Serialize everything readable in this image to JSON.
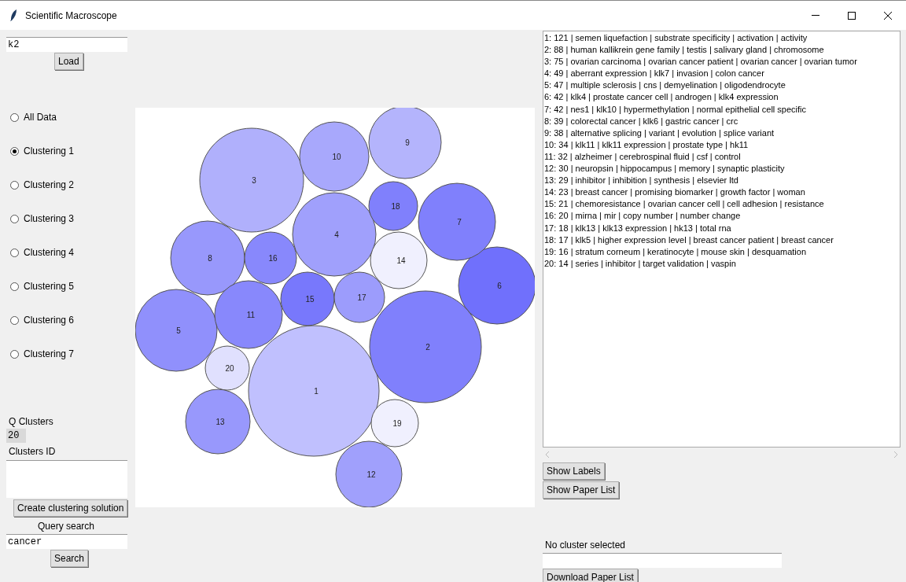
{
  "window": {
    "title": "Scientific Macroscope"
  },
  "left_panel": {
    "dataset_field": {
      "value": "k2"
    },
    "load_button": "Load",
    "options": [
      {
        "label": "All Data",
        "selected": false
      },
      {
        "label": "Clustering 1",
        "selected": true
      },
      {
        "label": "Clustering 2",
        "selected": false
      },
      {
        "label": "Clustering 3",
        "selected": false
      },
      {
        "label": "Clustering 4",
        "selected": false
      },
      {
        "label": "Clustering 5",
        "selected": false
      },
      {
        "label": "Clustering 6",
        "selected": false
      },
      {
        "label": "Clustering 7",
        "selected": false
      }
    ],
    "q_clusters_label": "Q Clusters",
    "q_clusters_value": "20",
    "clusters_id_label": "Clusters ID",
    "create_button": "Create clustering solution",
    "query_label": "Query search",
    "query_field": {
      "value": "cancer"
    },
    "search_button": "Search"
  },
  "bubbles": [
    {
      "label": "1",
      "color": "#c0c0fe"
    },
    {
      "label": "2",
      "color": "#8080fc"
    },
    {
      "label": "3",
      "color": "#b0b0fc"
    },
    {
      "label": "4",
      "color": "#a0a0fc"
    },
    {
      "label": "5",
      "color": "#9090fc"
    },
    {
      "label": "6",
      "color": "#7070fc"
    },
    {
      "label": "7",
      "color": "#8080fc"
    },
    {
      "label": "8",
      "color": "#9898fc"
    },
    {
      "label": "9",
      "color": "#b4b4fc"
    },
    {
      "label": "10",
      "color": "#a8a8fc"
    },
    {
      "label": "11",
      "color": "#8888fc"
    },
    {
      "label": "12",
      "color": "#a0a0fc"
    },
    {
      "label": "13",
      "color": "#9898fc"
    },
    {
      "label": "14",
      "color": "#f0f0fe"
    },
    {
      "label": "15",
      "color": "#7878fc"
    },
    {
      "label": "16",
      "color": "#8888fc"
    },
    {
      "label": "17",
      "color": "#9c9cfc"
    },
    {
      "label": "18",
      "color": "#8080fc"
    },
    {
      "label": "19",
      "color": "#f0f0fe"
    },
    {
      "label": "20",
      "color": "#e0e0fe"
    }
  ],
  "cluster_list": [
    "1: 121 | semen liquefaction | substrate specificity | activation | activity",
    "2: 88 | human kallikrein gene family | testis | salivary gland | chromosome",
    "3: 75 | ovarian carcinoma | ovarian cancer patient | ovarian cancer | ovarian tumor",
    "4: 49 | aberrant expression | klk7 | invasion | colon cancer",
    "5: 47 | multiple sclerosis | cns | demyelination | oligodendrocyte",
    "6: 42 | klk4 | prostate cancer cell | androgen | klk4 expression",
    "7: 42 | nes1 | klk10 | hypermethylation | normal epithelial cell specific",
    "8: 39 | colorectal cancer | klk6 | gastric cancer | crc",
    "9: 38 | alternative splicing | variant | evolution | splice variant",
    "10: 34 | klk11 | klk11 expression | prostate type | hk11",
    "11: 32 | alzheimer | cerebrospinal fluid | csf | control",
    "12: 30 | neuropsin | hippocampus | memory | synaptic plasticity",
    "13: 29 | inhibitor | inhibition | synthesis | elsevier ltd",
    "14: 23 | breast cancer | promising biomarker | growth factor | woman",
    "15: 21 | chemoresistance | ovarian cancer cell | cell adhesion | resistance",
    "16: 20 | mirna | mir | copy number | number change",
    "17: 18 | klk13 | klk13 expression | hk13 | total rna",
    "18: 17 | klk5 | higher expression level | breast cancer patient | breast cancer",
    "19: 16 | stratum corneum | keratinocyte | mouse skin | desquamation",
    "20: 14 | series | inhibitor | target validation | vaspin"
  ],
  "right_panel": {
    "show_labels_button": "Show Labels",
    "show_papers_button": "Show Paper List",
    "status": "No cluster selected",
    "download_button": "Download Paper List"
  }
}
